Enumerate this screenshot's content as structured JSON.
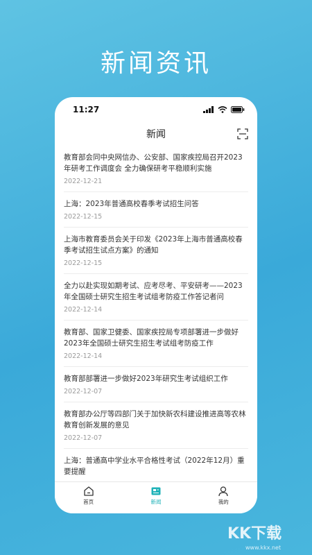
{
  "promo": {
    "title": "新闻资讯"
  },
  "status_bar": {
    "time": "11:27"
  },
  "header": {
    "title": "新闻"
  },
  "news": [
    {
      "title": "教育部会同中央网信办、公安部、国家疾控局召开2023年研考工作调度会 全力确保研考平稳顺利实施",
      "date": "2022-12-21"
    },
    {
      "title": "上海：2023年普通高校春季考试招生问答",
      "date": "2022-12-15"
    },
    {
      "title": "上海市教育委员会关于印发《2023年上海市普通高校春季考试招生试点方案》的通知",
      "date": "2022-12-15"
    },
    {
      "title": "全力以赴实现如期考试、应考尽考、平安研考——2023年全国硕士研究生招生考试组考防疫工作答记者问",
      "date": "2022-12-14"
    },
    {
      "title": "教育部、国家卫健委、国家疾控局专项部署进一步做好2023年全国硕士研究生招生考试组考防疫工作",
      "date": "2022-12-14"
    },
    {
      "title": "教育部部署进一步做好2023年研究生考试组织工作",
      "date": "2022-12-07"
    },
    {
      "title": "教育部办公厅等四部门关于加快新农科建设推进高等农林教育创新发展的意见",
      "date": "2022-12-07"
    },
    {
      "title": "上海：普通高中学业水平合格性考试（2022年12月）重要提醒",
      "date": ""
    }
  ],
  "tabs": [
    {
      "label": "首页",
      "icon": "home-icon"
    },
    {
      "label": "新闻",
      "icon": "news-icon"
    },
    {
      "label": "我的",
      "icon": "profile-icon"
    }
  ],
  "watermark": {
    "text": "KK下载",
    "url": "www.kkx.net"
  },
  "colors": {
    "accent": "#1fb2b8",
    "background": "#3aa9d9"
  }
}
